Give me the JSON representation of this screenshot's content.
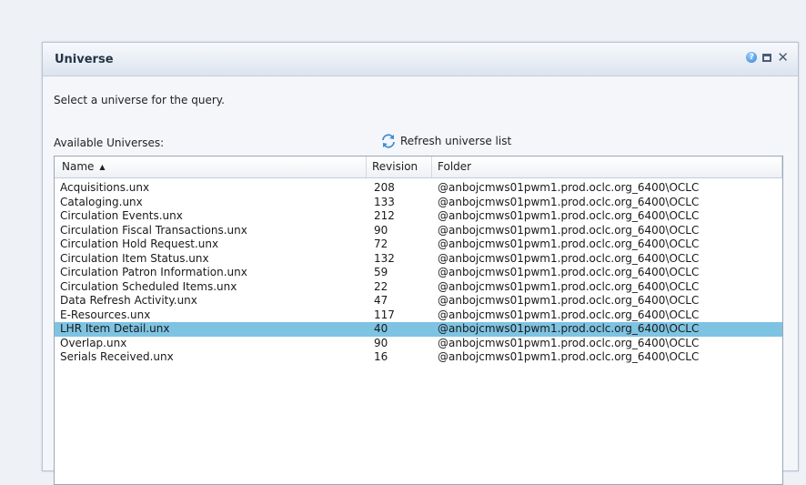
{
  "dialog": {
    "title": "Universe",
    "instruction": "Select a universe for the query.",
    "available_label": "Available Universes:",
    "refresh_label": "Refresh universe list",
    "icons": [
      "help-icon",
      "maximize-icon",
      "close-icon",
      "refresh-icon"
    ]
  },
  "table": {
    "columns": [
      "Name",
      "Revision",
      "Folder"
    ],
    "sort": {
      "column": "Name",
      "direction": "ascending"
    },
    "rows": [
      {
        "name": "Acquisitions.unx",
        "revision": "208",
        "folder": "@anbojcmws01pwm1.prod.oclc.org_6400\\OCLC"
      },
      {
        "name": "Cataloging.unx",
        "revision": "133",
        "folder": "@anbojcmws01pwm1.prod.oclc.org_6400\\OCLC"
      },
      {
        "name": "Circulation Events.unx",
        "revision": "212",
        "folder": "@anbojcmws01pwm1.prod.oclc.org_6400\\OCLC"
      },
      {
        "name": "Circulation Fiscal Transactions.unx",
        "revision": "90",
        "folder": "@anbojcmws01pwm1.prod.oclc.org_6400\\OCLC"
      },
      {
        "name": "Circulation Hold Request.unx",
        "revision": "72",
        "folder": "@anbojcmws01pwm1.prod.oclc.org_6400\\OCLC"
      },
      {
        "name": "Circulation Item Status.unx",
        "revision": "132",
        "folder": "@anbojcmws01pwm1.prod.oclc.org_6400\\OCLC"
      },
      {
        "name": "Circulation Patron Information.unx",
        "revision": "59",
        "folder": "@anbojcmws01pwm1.prod.oclc.org_6400\\OCLC"
      },
      {
        "name": "Circulation Scheduled Items.unx",
        "revision": "22",
        "folder": "@anbojcmws01pwm1.prod.oclc.org_6400\\OCLC"
      },
      {
        "name": "Data Refresh Activity.unx",
        "revision": "47",
        "folder": "@anbojcmws01pwm1.prod.oclc.org_6400\\OCLC"
      },
      {
        "name": "E-Resources.unx",
        "revision": "117",
        "folder": "@anbojcmws01pwm1.prod.oclc.org_6400\\OCLC"
      },
      {
        "name": "LHR Item Detail.unx",
        "revision": "40",
        "folder": "@anbojcmws01pwm1.prod.oclc.org_6400\\OCLC",
        "selected": true
      },
      {
        "name": "Overlap.unx",
        "revision": "90",
        "folder": "@anbojcmws01pwm1.prod.oclc.org_6400\\OCLC"
      },
      {
        "name": "Serials Received.unx",
        "revision": "16",
        "folder": "@anbojcmws01pwm1.prod.oclc.org_6400\\OCLC"
      }
    ]
  },
  "colors": {
    "selected_row": "#7ec3e2",
    "title_text": "#243447"
  }
}
